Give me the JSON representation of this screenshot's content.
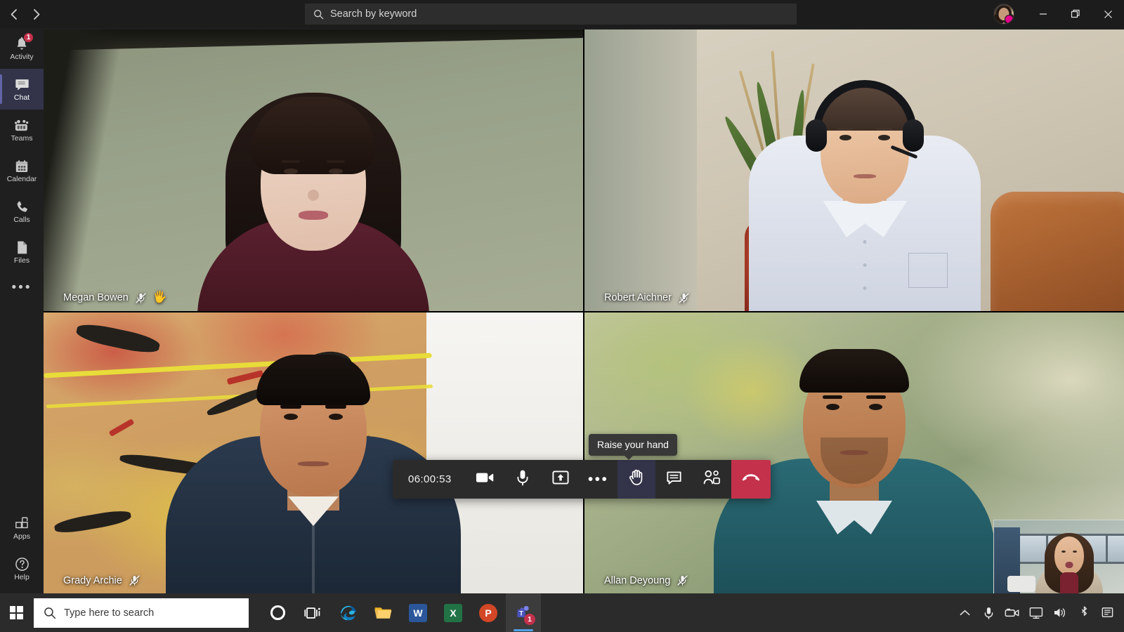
{
  "app": {
    "name": "Microsoft Teams",
    "nav": {
      "back_icon": "chevron-left-icon",
      "forward_icon": "chevron-right-icon"
    }
  },
  "search": {
    "placeholder": "Search by keyword",
    "icon": "search-icon"
  },
  "window_controls": {
    "minimize_label": "—",
    "restore_label": "❐",
    "close_label": "✕",
    "avatar_name": "avatar",
    "presence_color": "#e3008c"
  },
  "sidebar": {
    "items": [
      {
        "label": "Activity",
        "icon": "bell-icon",
        "badge": "1",
        "active": false
      },
      {
        "label": "Chat",
        "icon": "chat-icon",
        "badge": "",
        "active": true
      },
      {
        "label": "Teams",
        "icon": "teams-icon",
        "badge": "",
        "active": false
      },
      {
        "label": "Calendar",
        "icon": "calendar-icon",
        "badge": "",
        "active": false
      },
      {
        "label": "Calls",
        "icon": "phone-icon",
        "badge": "",
        "active": false
      },
      {
        "label": "Files",
        "icon": "files-icon",
        "badge": "",
        "active": false
      }
    ],
    "more_label": "•••",
    "bottom_items": [
      {
        "label": "Apps",
        "icon": "apps-icon"
      },
      {
        "label": "Help",
        "icon": "help-icon"
      }
    ],
    "active_accent": "#6264a7"
  },
  "call": {
    "participants": [
      {
        "name": "Megan Bowen",
        "muted": true,
        "mic_icon": "mic-off-icon",
        "hand_raised": true,
        "hand_icon": "🖐"
      },
      {
        "name": "Robert Aichner",
        "muted": true,
        "mic_icon": "mic-off-icon",
        "hand_raised": false,
        "hand_icon": ""
      },
      {
        "name": "Grady Archie",
        "muted": true,
        "mic_icon": "mic-off-icon",
        "hand_raised": false,
        "hand_icon": ""
      },
      {
        "name": "Allan Deyoung",
        "muted": true,
        "mic_icon": "mic-off-icon",
        "hand_raised": false,
        "hand_icon": ""
      }
    ],
    "timer": "06:00:53",
    "tooltip": "Raise your hand",
    "controls": [
      {
        "name": "camera",
        "icon": "video-camera-icon",
        "label": "Camera"
      },
      {
        "name": "microphone",
        "icon": "microphone-icon",
        "label": "Microphone"
      },
      {
        "name": "share-screen",
        "icon": "share-screen-icon",
        "label": "Share"
      },
      {
        "name": "more-actions",
        "icon": "ellipsis-icon",
        "label": "More actions"
      },
      {
        "name": "raise-hand",
        "icon": "raise-hand-icon",
        "label": "Raise your hand"
      },
      {
        "name": "show-conversation",
        "icon": "chat-bubble-icon",
        "label": "Show conversation"
      },
      {
        "name": "show-participants",
        "icon": "people-icon",
        "label": "Show participants"
      }
    ],
    "hangup": {
      "icon": "hangup-icon",
      "label": "Hang up",
      "color": "#c4314b"
    },
    "selfview_label": "self-view"
  },
  "taskbar": {
    "start_label": "Start",
    "search_placeholder": "Type here to search",
    "search_icon": "search-icon",
    "apps": [
      {
        "name": "cortana",
        "label": "Cortana",
        "badge": ""
      },
      {
        "name": "task-view",
        "label": "Task View",
        "badge": ""
      },
      {
        "name": "microsoft-edge",
        "label": "Microsoft Edge",
        "badge": ""
      },
      {
        "name": "file-explorer",
        "label": "File Explorer",
        "badge": ""
      },
      {
        "name": "word",
        "label": "Word",
        "badge": "",
        "glyph": "W",
        "color": "#2b579a"
      },
      {
        "name": "excel",
        "label": "Excel",
        "badge": "",
        "glyph": "X",
        "color": "#217346"
      },
      {
        "name": "powerpoint",
        "label": "PowerPoint",
        "badge": "",
        "glyph": "P",
        "color": "#d24726"
      },
      {
        "name": "microsoft-teams",
        "label": "Microsoft Teams",
        "badge": "1",
        "glyph": "T",
        "color": "#5b5fc7"
      }
    ],
    "tray": [
      {
        "name": "show-hidden-icons",
        "icon": "chevron-up-icon"
      },
      {
        "name": "microphone",
        "icon": "microphone-icon"
      },
      {
        "name": "camera",
        "icon": "camera-icon"
      },
      {
        "name": "display",
        "icon": "monitor-icon"
      },
      {
        "name": "volume",
        "icon": "speaker-icon"
      },
      {
        "name": "bluetooth",
        "icon": "bluetooth-icon"
      },
      {
        "name": "action-center",
        "icon": "action-center-icon"
      }
    ]
  }
}
